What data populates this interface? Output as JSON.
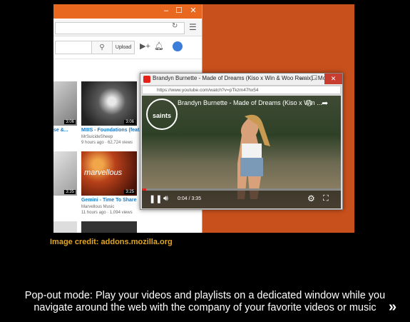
{
  "youtube": {
    "upload_label": "Upload",
    "videos": [
      {
        "title": "MIIIS - Foundations (feat.",
        "channel": "MrSuicideSheep",
        "meta": "9 hours ago · 62,724 views",
        "duration": "3:06"
      },
      {
        "title": "Gemini - Time To Share",
        "channel": "Marvellous Music",
        "meta": "11 hours ago · 1,094 views",
        "duration": "3:25",
        "thumb_text": "marvellous"
      }
    ],
    "left_col_durations": [
      "3:06",
      "3:35"
    ],
    "left_col_title": "se &..."
  },
  "popout": {
    "window_title": "Brandyn Burnette - Made of Dreams (Kiso x Win & Woo Remix) - Mo...",
    "url": "https://www.youtube.com/watch?v=pTkzm47hx54",
    "video_title": "Brandyn Burnette - Made of Dreams (Kiso x Win ...",
    "logo_text": "saints",
    "time": "0:04 / 3:35",
    "progress": 0.02
  },
  "credit": "Image credit: addons.mozilla.org",
  "caption_line1": "Pop-out mode: Play your videos and playlists on a dedicated window while you",
  "caption_line2": "navigate around the web with the company of your favorite videos or music",
  "next_icon": "double-chevron-right-icon",
  "colors": {
    "background": "#000000",
    "stage": "#c8501d",
    "credit": "#e0a622",
    "yt_red": "#e62117",
    "link": "#167ac6"
  }
}
